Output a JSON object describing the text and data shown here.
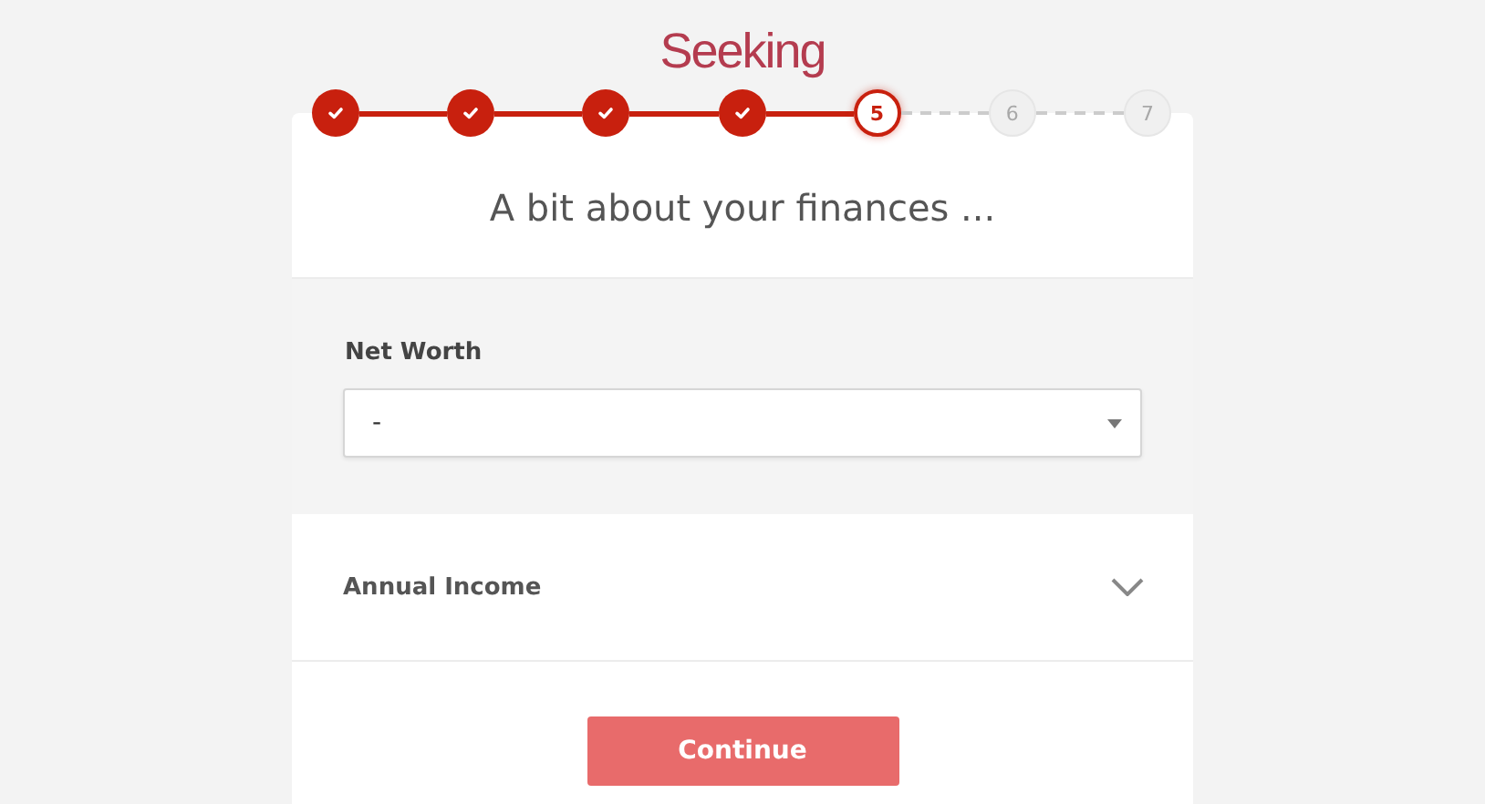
{
  "logo": "Seeking",
  "steps": [
    {
      "completed": true,
      "selected": false
    },
    {
      "completed": true,
      "selected": false
    },
    {
      "completed": true,
      "selected": false
    },
    {
      "completed": true,
      "selected": false
    },
    {
      "completed": false,
      "selected": true,
      "label": "5"
    },
    {
      "completed": false,
      "selected": false,
      "label": "6"
    },
    {
      "completed": false,
      "selected": false,
      "label": "7"
    }
  ],
  "title": "A bit about your finances ...",
  "fields": [
    {
      "kind": "select",
      "label": "Net Worth",
      "value": "-"
    },
    {
      "kind": "collapsed",
      "label": "Annual Income"
    }
  ],
  "button": "Continue"
}
